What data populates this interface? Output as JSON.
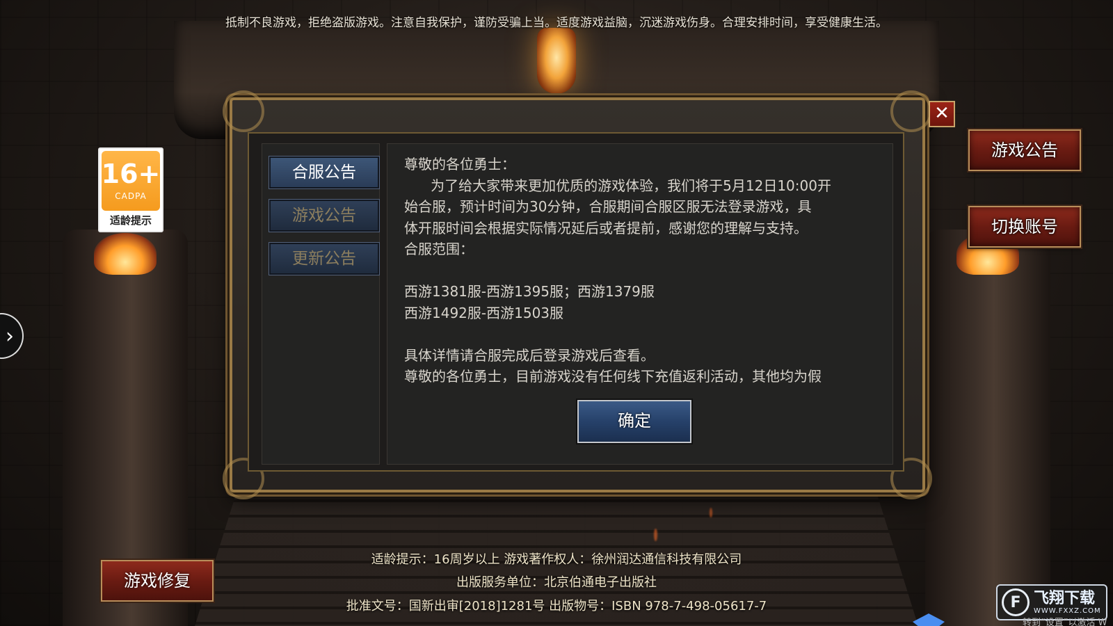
{
  "top_notice": "抵制不良游戏，拒绝盗版游戏。注意自我保护，谨防受骗上当。适度游戏益脑，沉迷游戏伤身。合理安排时间，享受健康生活。",
  "age_badge": {
    "age": "16+",
    "org": "CADPA",
    "label": "适龄提示"
  },
  "side_buttons": {
    "game_notice": "游戏公告",
    "switch_account": "切换账号",
    "game_repair": "游戏修复"
  },
  "dialog": {
    "tabs": [
      {
        "label": "合服公告",
        "active": true
      },
      {
        "label": "游戏公告",
        "active": false
      },
      {
        "label": "更新公告",
        "active": false
      }
    ],
    "content": {
      "greeting": "尊敬的各位勇士：",
      "line1": "      为了给大家带来更加优质的游戏体验，我们将于5月12日10:00开",
      "line2": "始合服，预计时间为30分钟，合服期间合服区服无法登录游戏，具",
      "line3": "体开服时间会根据实际情况延后或者提前，感谢您的理解与支持。",
      "scope_title": "合服范围：",
      "scope1": "西游1381服-西游1395服；西游1379服",
      "scope2": "西游1492服-西游1503服",
      "detail": "具体详情请合服完成后登录游戏后查看。",
      "notice2": "尊敬的各位勇士，目前游戏没有任何线下充值返利活动，其他均为假"
    },
    "confirm_label": "确定",
    "close_glyph": "✕"
  },
  "bottom_info": {
    "line1": "适龄提示：16周岁以上 游戏著作权人：徐州润达通信科技有限公司",
    "line2": "出版服务单位：北京伯通电子出版社",
    "line3": "批准文号：国新出审[2018]1281号 出版物号：ISBN 978-7-498-05617-7"
  },
  "watermark": {
    "name": "飞翔下载",
    "site": "WWW.FXXZ.COM",
    "hint": "转到“设置”以激活 W"
  },
  "icons": {
    "side_arrow": "chevron-right-icon",
    "close": "close-icon"
  },
  "colors": {
    "accent_gold": "#9a7a45",
    "tab_blue": "#2f3f57",
    "button_red": "#6a1b12",
    "age_orange": "#f59b1e"
  }
}
